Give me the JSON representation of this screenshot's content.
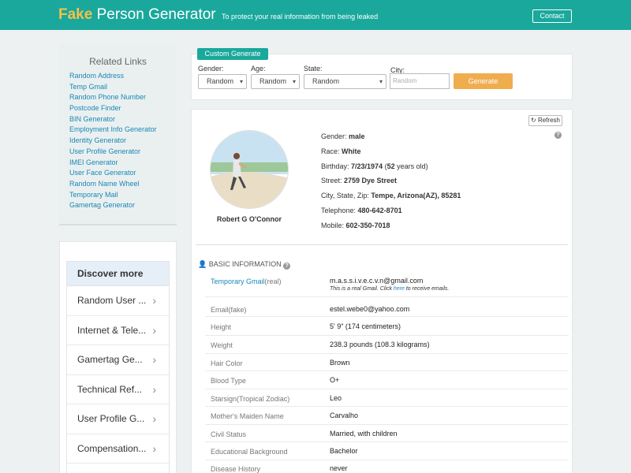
{
  "header": {
    "brand_fake": "Fake",
    "brand_rest": " Person Generator",
    "tagline": "To protect your real information from being leaked",
    "contact_label": "Contact"
  },
  "related": {
    "title": "Related Links",
    "links": [
      "Random Address",
      "Temp Gmail",
      "Random Phone Number",
      "Postcode Finder",
      "BIN Generator",
      "Employment Info Generator",
      "Identity Generator",
      "User Profile Generator",
      "IMEI Generator",
      "User Face Generator",
      "Random Name Wheel",
      "Temporary Mail",
      "Gamertag Generator"
    ]
  },
  "discover": {
    "title": "Discover more",
    "items": [
      "Random User ...",
      "Internet & Tele...",
      "Gamertag Ge...",
      "Technical Ref...",
      "User Profile G...",
      "Compensation..."
    ]
  },
  "custom": {
    "tab_label": "Custom Generate",
    "gender_label": "Gender:",
    "gender_value": "Random",
    "age_label": "Age:",
    "age_value": "Random",
    "state_label": "State:",
    "state_value": "Random",
    "city_label": "City:",
    "city_placeholder": "Random",
    "generate_label": "Generate"
  },
  "person": {
    "refresh_label": "Refresh",
    "name": "Robert G O'Connor",
    "gender_label": "Gender: ",
    "gender": "male",
    "race_label": "Race: ",
    "race": "White",
    "birthday_label": "Birthday: ",
    "birthday": "7/23/1974",
    "age_open": " (",
    "age": "52",
    "age_close": " years old)",
    "street_label": "Street: ",
    "street": "2759 Dye Street",
    "csz_label": "City, State, Zip: ",
    "csz": "Tempe, Arizona(AZ), 85281",
    "telephone_label": "Telephone: ",
    "telephone": "480-642-8701",
    "mobile_label": "Mobile: ",
    "mobile": "602-350-7018"
  },
  "basic": {
    "title": "BASIC INFORMATION",
    "gmail_label": "Temporary Gmail",
    "gmail_suffix": "(real)",
    "gmail_value": "m.a.s.s.i.v.e.c.v.n@gmail.com",
    "gmail_note_pre": "This is a real Gmail. Click ",
    "gmail_note_link": "here",
    "gmail_note_post": " to receive emails.",
    "rows": [
      {
        "label": "Email(fake)",
        "value": "estel.webe0@yahoo.com"
      },
      {
        "label": "Height",
        "value": "5' 9\" (174 centimeters)"
      },
      {
        "label": "Weight",
        "value": "238.3 pounds (108.3 kilograms)"
      },
      {
        "label": "Hair Color",
        "value": "Brown"
      },
      {
        "label": "Blood Type",
        "value": "O+"
      },
      {
        "label": "Starsign(Tropical Zodiac)",
        "value": "Leo"
      },
      {
        "label": "Mother's Maiden Name",
        "value": "Carvalho"
      },
      {
        "label": "Civil Status",
        "value": "Married, with children"
      },
      {
        "label": "Educational Background",
        "value": "Bachelor"
      },
      {
        "label": "Disease History",
        "value": "never"
      }
    ]
  },
  "colors": {
    "teal": "#1aa89c",
    "gold": "#f3c24a",
    "orange": "#f0ad4e",
    "link": "#1a87b8"
  }
}
